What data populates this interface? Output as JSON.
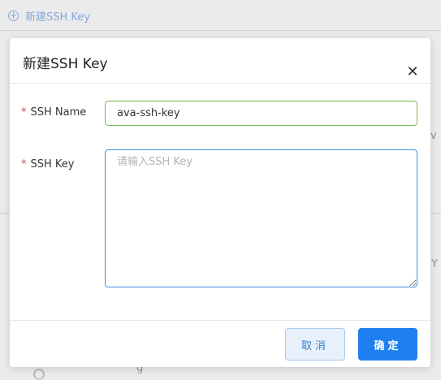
{
  "background": {
    "new_ssh_key_link": "新建SSH Key",
    "fragment_right_1": "v",
    "fragment_right_2": "Y",
    "fragment_bottom": "g"
  },
  "dialog": {
    "title": "新建SSH Key",
    "close_icon": "close-icon",
    "fields": {
      "ssh_name": {
        "required_mark": "*",
        "label": "SSH Name",
        "value": "ava-ssh-key"
      },
      "ssh_key": {
        "required_mark": "*",
        "label": "SSH Key",
        "value": "",
        "placeholder": "请输入SSH Key"
      }
    },
    "buttons": {
      "cancel_label": "取消",
      "ok_label": "确定"
    }
  },
  "colors": {
    "primary": "#1e7ff0",
    "input_valid_border": "#7ab85a",
    "input_focus_border": "#3a8fe3",
    "required": "#e04545"
  }
}
